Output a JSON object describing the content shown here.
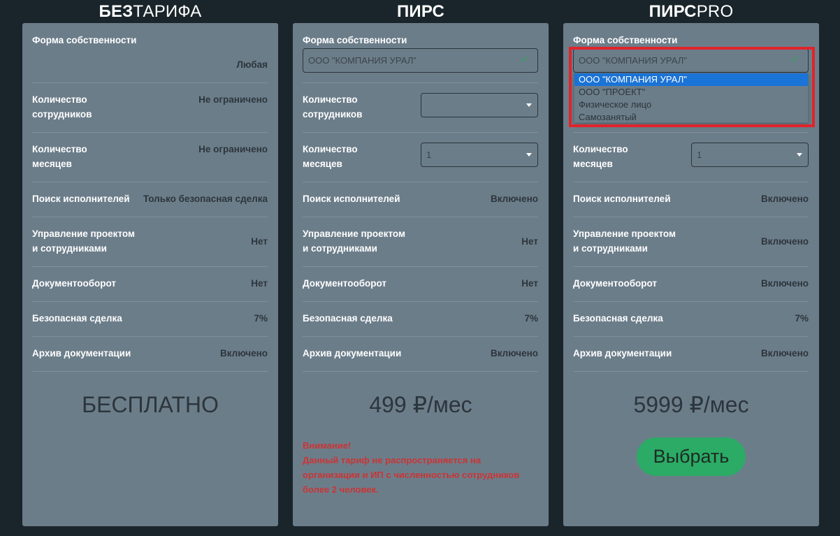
{
  "plans": [
    {
      "title_bold": "БЕЗ",
      "title_light": "ТАРИФА",
      "ownership_label": "Форма собственности",
      "ownership_value": "Любая",
      "employees_label_1": "Количество",
      "employees_label_2": "сотрудников",
      "employees_value": "Не ограничено",
      "months_label_1": "Количество",
      "months_label_2": "месяцев",
      "months_value": "Не ограничено",
      "search_label": "Поиск исполнителей",
      "search_value": "Только безопасная сделка",
      "project_label_1": "Управление проектом",
      "project_label_2": "и сотрудниками",
      "project_value": "Нет",
      "docs_label": "Документооборот",
      "docs_value": "Нет",
      "deal_label": "Безопасная сделка",
      "deal_value": "7%",
      "archive_label": "Архив документации",
      "archive_value": "Включено",
      "price": "БЕСПЛАТНО"
    },
    {
      "title_bold": "ПИРС",
      "title_light": "",
      "ownership_label": "Форма собственности",
      "ownership_select": "ООО \"КОМПАНИЯ УРАЛ\"",
      "employees_label_1": "Количество",
      "employees_label_2": "сотрудников",
      "employees_select": "",
      "months_label_1": "Количество",
      "months_label_2": "месяцев",
      "months_select": "1",
      "search_label": "Поиск исполнителей",
      "search_value": "Включено",
      "project_label_1": "Управление проектом",
      "project_label_2": "и сотрудниками",
      "project_value": "Нет",
      "docs_label": "Документооборот",
      "docs_value": "Нет",
      "deal_label": "Безопасная сделка",
      "deal_value": "7%",
      "archive_label": "Архив документации",
      "archive_value": "Включено",
      "price": "499 ₽/мес",
      "warning_title": "Внимание!",
      "warning_text": "Данный тариф не распространяется на организации и ИП с численностью сотрудников более 2 человек."
    },
    {
      "title_bold": "ПИРС",
      "title_light": "PRO",
      "ownership_label": "Форма собственности",
      "ownership_select": "ООО \"КОМПАНИЯ УРАЛ\"",
      "months_label_1": "Количество",
      "months_label_2": "месяцев",
      "months_select": "1",
      "search_label": "Поиск исполнителей",
      "search_value": "Включено",
      "project_label_1": "Управление проектом",
      "project_label_2": "и сотрудниками",
      "project_value": "Включено",
      "docs_label": "Документооборот",
      "docs_value": "Включено",
      "deal_label": "Безопасная сделка",
      "deal_value": "7%",
      "archive_label": "Архив документации",
      "archive_value": "Включено",
      "price": "5999 ₽/мес",
      "button_label": "Выбрать",
      "dropdown_options": [
        "ООО \"КОМПАНИЯ УРАЛ\"",
        "ООО \"ПРОЕКТ\"",
        "Физическое лицо",
        "Самозанятый"
      ]
    }
  ],
  "colors": {
    "background": "#1a252b",
    "card": "#6c7d8a",
    "accent_green": "#2bab65",
    "warning_red": "#cb3434",
    "highlight_red": "#e0242b",
    "selected_blue": "#1a73d6"
  }
}
